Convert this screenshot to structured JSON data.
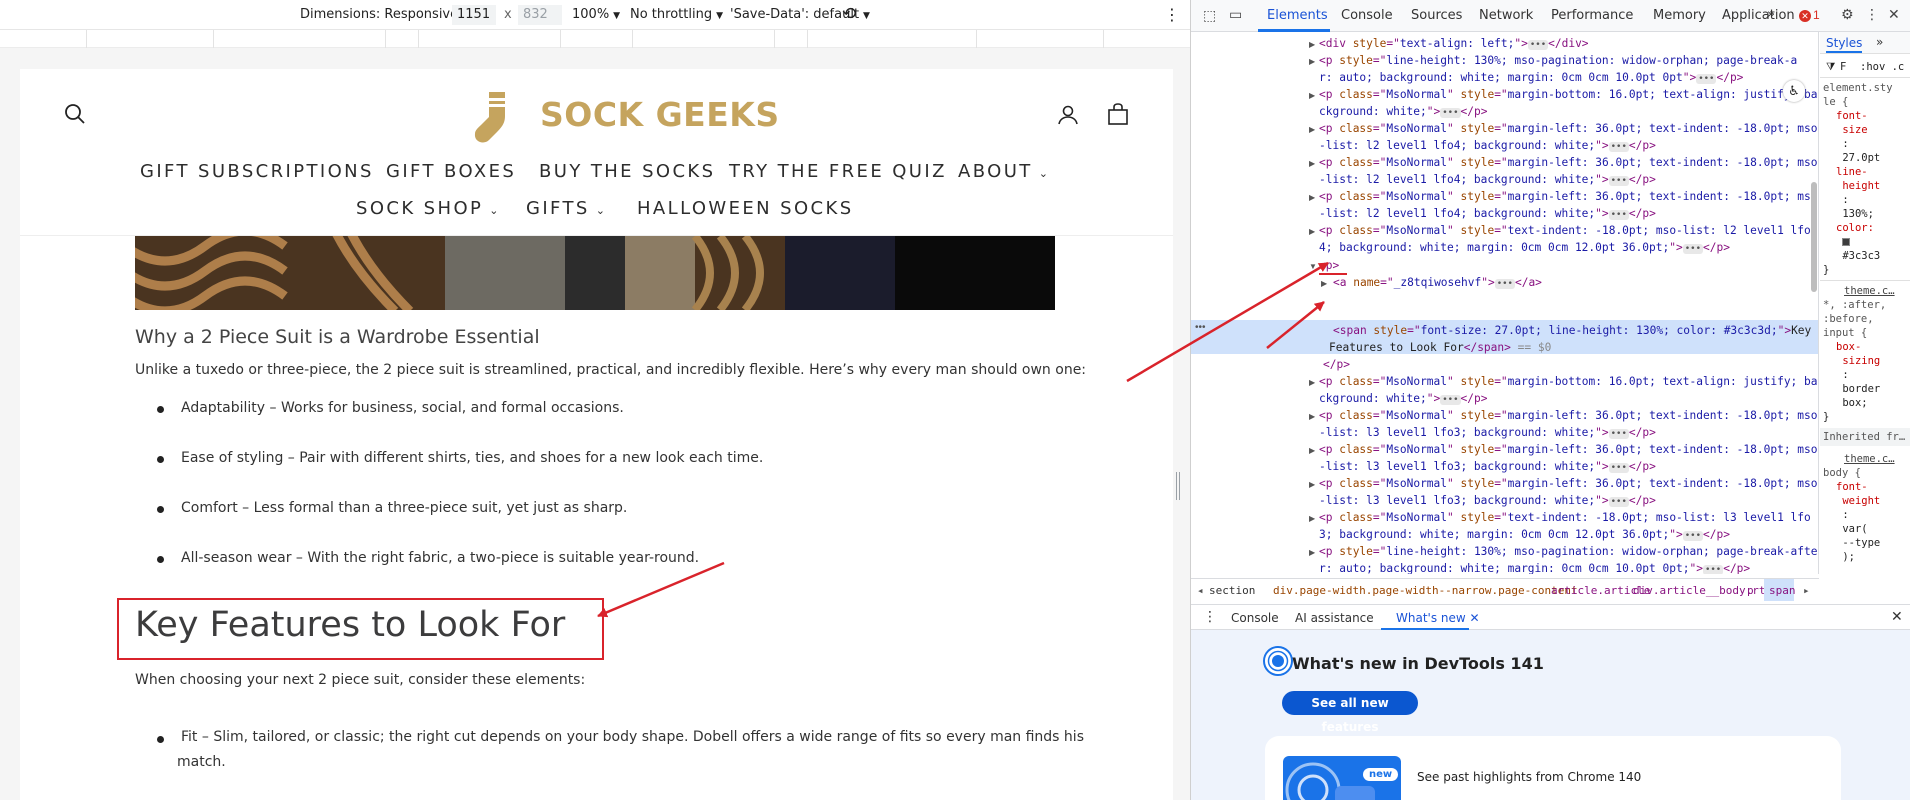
{
  "device_toolbar": {
    "dimensions_label": "Dimensions: Responsive",
    "width_value": "1151",
    "x_sep": "x",
    "height_placeholder": "832",
    "zoom": "100%",
    "throttling": "No throttling",
    "save_data": "'Save-Data': default"
  },
  "site": {
    "logo_text": "SOCK GEEKS",
    "nav_row1": [
      "GIFT SUBSCRIPTIONS",
      "GIFT BOXES",
      "BUY THE SOCKS",
      "TRY THE FREE QUIZ",
      "ABOUT"
    ],
    "nav_row2": [
      "SOCK SHOP",
      "GIFTS",
      "HALLOWEEN SOCKS"
    ]
  },
  "article": {
    "h3": "Why a 2 Piece Suit is a Wardrobe Essential",
    "intro": "Unlike a tuxedo or three-piece, the 2 piece suit is streamlined, practical, and incredibly flexible. Here’s why every man should own one:",
    "bullets": [
      "Adaptability – Works for business, social, and formal occasions.",
      "Ease of styling – Pair with different shirts, ties, and shoes for a new look each time.",
      "Comfort – Less formal than a three-piece suit, yet just as sharp.",
      "All-season wear – With the right fabric, a two-piece is suitable year-round."
    ],
    "h2": "Key Features to Look For",
    "choose": "When choosing your next 2 piece suit, consider these elements:",
    "fit_line1": "Fit – Slim, tailored, or classic; the right cut depends on your body shape. Dobell offers a wide range of fits so every man finds his",
    "fit_line2": "match."
  },
  "devtools": {
    "tabs": [
      "Elements",
      "Console",
      "Sources",
      "Network",
      "Performance",
      "Memory",
      "Application"
    ],
    "more_tabs": "»",
    "error_count": "1",
    "styles_tabs": [
      "Styles",
      "»"
    ],
    "filter_text": "F",
    "hov_text": ":hov .c",
    "breadcrumbs": [
      "section",
      "div.page-width.page-width--narrow.page-content",
      "article.article",
      "div.article__body.rte",
      "p",
      "span"
    ],
    "drawer_tabs": [
      "Console",
      "AI assistance",
      "What's new"
    ],
    "whatsnew_title": "What's new in DevTools 141",
    "whatsnew_button": "See all new features",
    "whatsnew_badge": "new",
    "whatsnew_past": "See past highlights from Chrome 140",
    "sel_marker": "== $0",
    "dom_lines": {
      "l0a": "<div ",
      "l0b": "style",
      "l0c": "=\"",
      "l0d": "text-align: left;",
      "l0e": "\">",
      "l0f": "</div>",
      "lh130a": "line-height: 130%; mso-pagination: widow-orphan; page-break-a",
      "lh130b": "r: auto; background: white; margin: 0cm 0cm 10.0pt 0pt",
      "mb16a": "margin-bottom: 16.0pt; text-align: justify; ba",
      "mb16b": "ckground: white;",
      "ml36a": "margin-left: 36.0pt; text-indent: -18.0pt; mso",
      "ml36b4": "-list: l2 level1 lfo4; background: white;",
      "ml36b3": "-list: l3 level1 lfo3; background: white;",
      "ti1": "text-indent: -18.0pt; mso-list: l2 level1 lfo",
      "ti1b": "4; background: white; margin: 0cm 0cm 12.0pt 36.0pt;",
      "ti2": "text-indent: -18.0pt; mso-list: l3 level1 lfo",
      "ti2b": "3; background: white; margin: 0cm 0cm 12.0pt 36.0pt;",
      "lh130c": "line-height: 130%; mso-pagination: widow-orphan; page-break-afte",
      "lh130d": "r: auto; background: white; margin: 0cm 0cm 10.0pt 0pt;",
      "a_name": "_z8tqiwosehvf",
      "span_style": "font-size: 27.0pt; line-height: 130%; color: #3c3c3d;",
      "span_text1": "Key",
      "span_text2": "Features to Look For",
      "msonormal": "MsoNormal"
    },
    "styles_pane": {
      "element_style1": "element.sty",
      "element_style2": "le {",
      "prop_fs": "font-",
      "prop_fs2": "size",
      "colon": ":",
      "val_fs": "27.0pt",
      "prop_lh": "line-",
      "prop_lh2": "height",
      "val_lh": "130%;",
      "prop_color": "color:",
      "val_color": "#3c3c3",
      "close": "}",
      "theme1": "theme.c…",
      "sel_all": "*, :after,",
      "sel_all2": ":before,",
      "sel_all3": "input {",
      "box1": "box-",
      "box2": "sizing",
      "box3": "border",
      "box4": "box;",
      "inherited": "Inherited fr…",
      "theme2": "theme.c…",
      "body": "body {",
      "fw1": "font-",
      "fw2": "weight",
      "fw3": "var(",
      "fw4": "--type",
      "fw5": ");"
    }
  },
  "colors": {
    "logo_gold": "#c5a45e",
    "annotation_red": "#d9232b",
    "devtools_blue": "#1a73e8"
  }
}
